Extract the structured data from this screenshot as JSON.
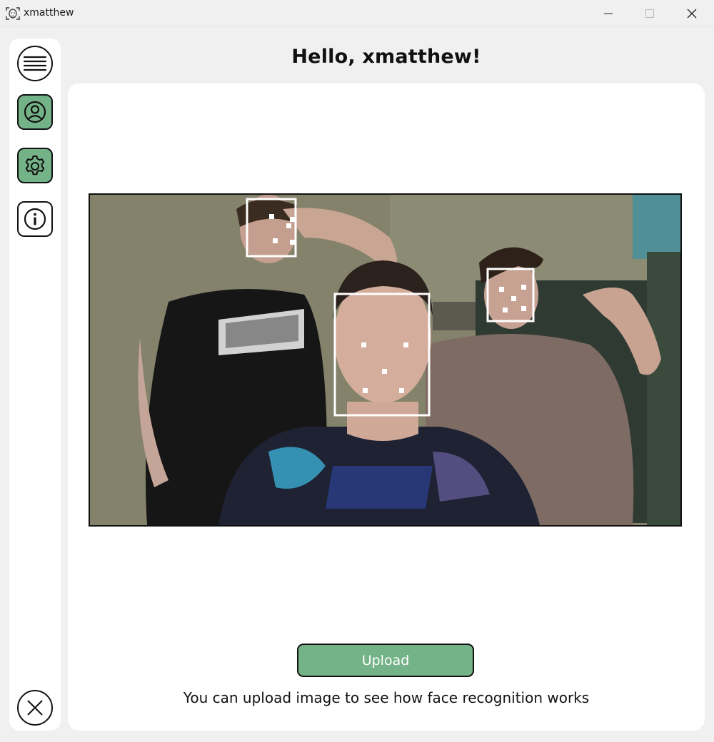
{
  "window": {
    "title": "xmatthew",
    "app_icon": "face-scan-icon",
    "controls": [
      "minimize-icon",
      "maximize-icon",
      "close-icon"
    ]
  },
  "sidebar": {
    "items": [
      {
        "name": "menu",
        "icon": "hamburger-menu-icon"
      },
      {
        "name": "profile",
        "icon": "user-profile-icon",
        "active_color": "#74b287"
      },
      {
        "name": "settings",
        "icon": "gear-icon",
        "active_color": "#74b287"
      },
      {
        "name": "info",
        "icon": "info-icon"
      },
      {
        "name": "exit",
        "icon": "close-icon"
      }
    ]
  },
  "main": {
    "greeting": "Hello, xmatthew!",
    "image": {
      "description_icon": "webcam-photo",
      "detected_faces": 3
    },
    "upload_label": "Upload",
    "hint": "You can upload image to see how face recognition works"
  },
  "colors": {
    "accent": "#74b287",
    "background": "#f0f0f0",
    "panel": "#ffffff",
    "border": "#111111"
  }
}
